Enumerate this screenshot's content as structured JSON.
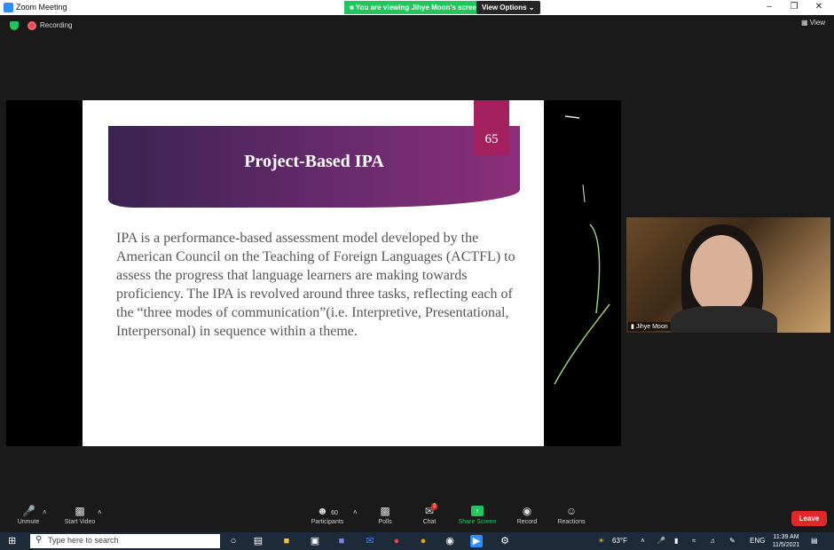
{
  "window": {
    "title": "Zoom Meeting",
    "viewing_banner": "You are viewing Jihye Moon's screen",
    "view_options": "View Options ⌄",
    "controls": [
      "–",
      "❐",
      "✕"
    ]
  },
  "meeting": {
    "recording_label": "Recording",
    "view_label": "View"
  },
  "slide": {
    "title": "Project-Based IPA",
    "number": "65",
    "body": "IPA is a performance-based assessment model developed by the American Council on the Teaching of Foreign Languages (ACTFL) to assess the progress that language learners are making towards proficiency. The IPA is revolved around three tasks, reflecting each of the “three modes of communication”(i.e. Interpretive, Presentational, Interpersonal) in sequence within a theme."
  },
  "participant_video": {
    "name": "Jihye Moon"
  },
  "toolbar": {
    "unmute": "Unmute",
    "start_video": "Start Video",
    "participants": "Participants",
    "participants_count": "60",
    "polls": "Polls",
    "chat": "Chat",
    "chat_badge": "2",
    "share_screen": "Share Screen",
    "record": "Record",
    "reactions": "Reactions",
    "leave": "Leave"
  },
  "taskbar": {
    "search_placeholder": "Type here to search",
    "weather": "63°F",
    "language": "ENG",
    "time": "11:39 AM",
    "date": "11/5/2021"
  },
  "colors": {
    "accent_green": "#22c55e",
    "leave_red": "#e02828",
    "slide_band": "#6b2b6e",
    "slide_number": "#a3215f"
  }
}
